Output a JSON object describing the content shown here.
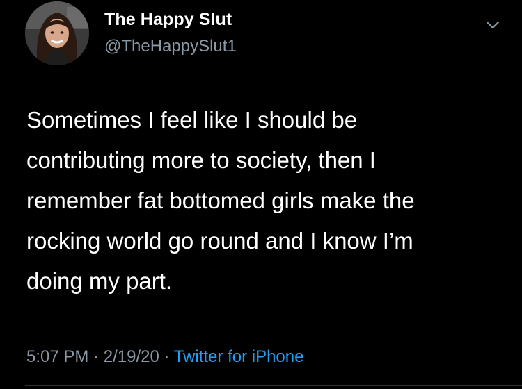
{
  "tweet": {
    "display_name": "The Happy Slut",
    "handle": "@TheHappySlut1",
    "more_icon": "chevron-down-icon",
    "text_lines": [
      "Sometimes I feel like I should be",
      "contributing more to society, then I",
      "remember fat bottomed girls make the",
      "rocking world go round and I know I’m",
      "doing my part."
    ],
    "time": "5:07 PM",
    "separator": "·",
    "date": "2/19/20",
    "source": "Twitter for iPhone"
  },
  "colors": {
    "background": "#000000",
    "text": "#ffffff",
    "secondary": "#8b98a5",
    "link": "#1da1f2"
  }
}
